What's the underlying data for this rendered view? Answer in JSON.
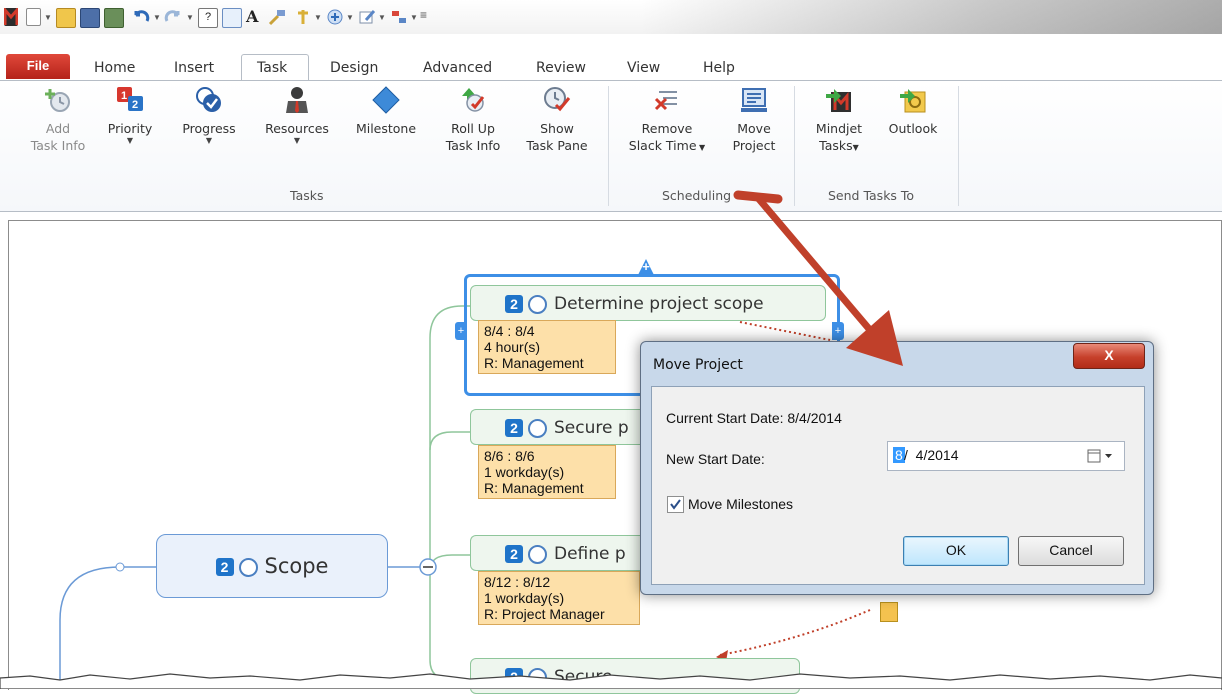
{
  "ribbon_tabs": {
    "file": "File",
    "home": "Home",
    "insert": "Insert",
    "task": "Task",
    "design": "Design",
    "advanced": "Advanced",
    "review": "Review",
    "view": "View",
    "help": "Help"
  },
  "ribbon": {
    "add_task_info": [
      "Add",
      "Task Info"
    ],
    "priority": "Priority",
    "progress": "Progress",
    "resources": "Resources",
    "milestone": "Milestone",
    "roll_up": [
      "Roll Up",
      "Task Info"
    ],
    "show_task_pane": [
      "Show",
      "Task Pane"
    ],
    "remove_slack": [
      "Remove",
      "Slack Time"
    ],
    "move_project": [
      "Move",
      "Project"
    ],
    "mindjet_tasks": [
      "Mindjet",
      "Tasks"
    ],
    "outlook": "Outlook",
    "group_tasks": "Tasks",
    "group_scheduling": "Scheduling",
    "group_send_tasks": "Send Tasks To"
  },
  "map": {
    "central": {
      "priority": "2",
      "label": "Scope"
    },
    "topics": [
      {
        "priority": "2",
        "label": "Determine project scope",
        "info": [
          "8/4 : 8/4",
          "4 hour(s)",
          "R: Management"
        ]
      },
      {
        "priority": "2",
        "label": "Secure p",
        "info": [
          "8/6 : 8/6",
          "1 workday(s)",
          "R: Management"
        ]
      },
      {
        "priority": "2",
        "label": "Define p",
        "info": [
          "8/12 : 8/12",
          "1 workday(s)",
          "R: Project Manager"
        ]
      },
      {
        "priority": "2",
        "label": "Secure"
      }
    ]
  },
  "dialog": {
    "title": "Move Project",
    "close": "X",
    "current_start_label": "Current Start Date: 8/4/2014",
    "new_start_label": "New Start Date:",
    "new_start_month": "8",
    "new_start_rest": "/  4/2014",
    "move_milestones_label": "Move Milestones",
    "move_milestones_checked": true,
    "ok": "OK",
    "cancel": "Cancel"
  },
  "colors": {
    "annotation_arrow": "#c0402a",
    "info_box": "#fde0a9",
    "priority_badge": "#1f74c9",
    "branch_line": "#8fc69b"
  }
}
